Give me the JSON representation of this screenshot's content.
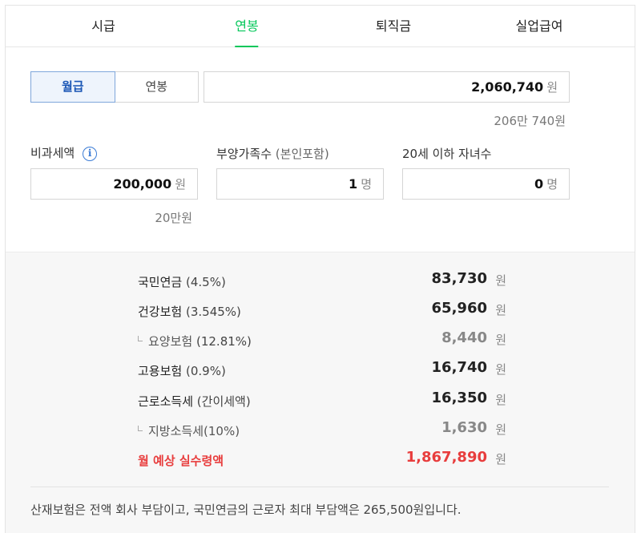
{
  "tabs": [
    "시급",
    "연봉",
    "퇴직금",
    "실업급여"
  ],
  "active_tab": "연봉",
  "pay_type": {
    "options": [
      "월급",
      "연봉"
    ],
    "selected": "월급"
  },
  "salary": {
    "value": "2,060,740",
    "unit": "원",
    "korean": "206만 740원"
  },
  "non_taxable": {
    "label": "비과세액",
    "value": "200,000",
    "unit": "원",
    "korean": "20만원"
  },
  "dependents": {
    "label": "부양가족수",
    "label_sub": "(본인포함)",
    "value": "1",
    "unit": "명"
  },
  "children": {
    "label": "20세 이하 자녀수",
    "value": "0",
    "unit": "명"
  },
  "deductions": {
    "pension": {
      "name": "국민연금",
      "rate": "(4.5%)",
      "amount": "83,730",
      "unit": "원"
    },
    "health": {
      "name": "건강보험",
      "rate": "(3.545%)",
      "amount": "65,960",
      "unit": "원"
    },
    "care": {
      "name": "요양보험",
      "rate": "(12.81%)",
      "amount": "8,440",
      "unit": "원"
    },
    "employment": {
      "name": "고용보험",
      "rate": "(0.9%)",
      "amount": "16,740",
      "unit": "원"
    },
    "income_tax": {
      "name": "근로소득세",
      "rate": "(간이세액)",
      "amount": "16,350",
      "unit": "원"
    },
    "local_tax": {
      "name": "지방소득세(10%)",
      "amount": "1,630",
      "unit": "원"
    },
    "net": {
      "name": "월 예상 실수령액",
      "amount": "1,867,890",
      "unit": "원"
    }
  },
  "note": "산재보험은 전액 회사 부담이고, 국민연금의 근로자 최대 부담액은 265,500원입니다.",
  "colors": {
    "accent_green": "#03c75a",
    "highlight_red": "#e83d3d",
    "info_blue": "#3a7bd5"
  }
}
